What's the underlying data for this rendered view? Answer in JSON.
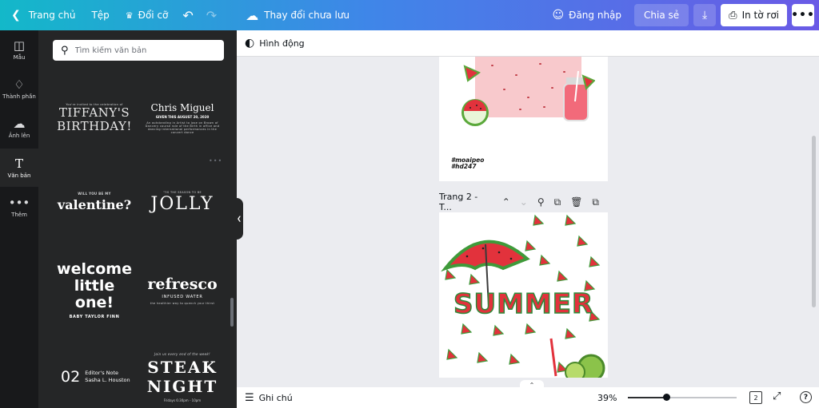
{
  "topbar": {
    "home_label": "Trang chủ",
    "file_label": "Tệp",
    "resize_label": "Đổi cỡ",
    "save_status": "Thay đổi chưa lưu",
    "login_label": "Đăng nhập",
    "share_label": "Chia sẻ",
    "print_label": "In tờ rơi"
  },
  "rail": {
    "items": [
      {
        "label": "Mẫu",
        "icon": "template-icon"
      },
      {
        "label": "Thành phần",
        "icon": "elements-icon"
      },
      {
        "label": "Ảnh lên",
        "icon": "upload-cloud-icon"
      },
      {
        "label": "Văn bản",
        "icon": "text-icon"
      },
      {
        "label": "Thêm",
        "icon": "more-icon"
      }
    ],
    "active": "Văn bản"
  },
  "panel": {
    "search_placeholder": "Tìm kiếm văn bản",
    "templates": [
      {
        "small": "You're invited to the celebration of",
        "big_line1": "TIFFANY'S",
        "big_line2": "BIRTHDAY!"
      },
      {
        "big": "Chris Miguel",
        "mid": "GIVEN THIS AUGUST 20, 2020",
        "small": "An outstanding in Artist to Jose on Brown of Dancery course role of the Birth in office and dancing international performances in the concert dance"
      },
      {
        "small": "WILL YOU BE MY",
        "big": "valentine?"
      },
      {
        "small": "'TIS THE SEASON TO BE",
        "big": "JOLLY"
      },
      {
        "big_line1": "welcome",
        "big_line2": "little one!",
        "small": "BABY TAYLOR FINN"
      },
      {
        "big": "refresco",
        "mid": "INFUSED WATER",
        "small": "the healthier way to quench your thirst"
      },
      {
        "num": "02",
        "line1": "Editor's Note",
        "line2": "Sasha L. Houston"
      },
      {
        "small": "Join us every end of the week!",
        "big_line1": "STEAK",
        "big_line2": "NIGHT",
        "foot": "Fridays 6:30pm - 10pm"
      }
    ]
  },
  "canvas": {
    "animate_label": "Hình động",
    "page1_hashtag1": "#moaipeo",
    "page1_hashtag2": "#hd247",
    "page2_label": "Trang 2 - T...",
    "page2_title": "SUMMER"
  },
  "footer": {
    "notes_label": "Ghi chú",
    "zoom": "39%",
    "zoom_fraction": 0.35,
    "page_count": "2"
  },
  "colors": {
    "topbar_start": "#13b8c9",
    "topbar_end": "#6a5ae6",
    "panel_bg": "#252627",
    "rail_bg": "#18191b",
    "canvas_bg": "#ebecf0",
    "watermelon_red": "#e2323c",
    "watermelon_green": "#2e8a3a"
  }
}
